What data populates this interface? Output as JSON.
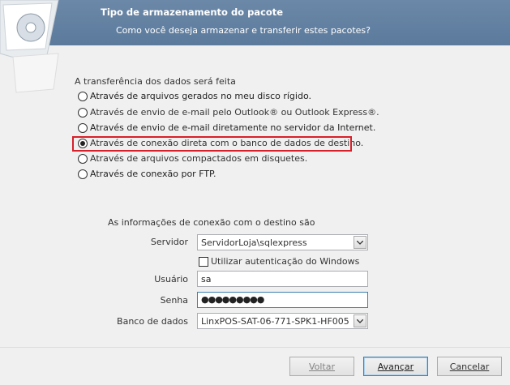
{
  "header": {
    "title": "Tipo de armazenamento do pacote",
    "subtitle": "Como você deseja armazenar e transferir estes pacotes?"
  },
  "transfer": {
    "label": "A transferência dos dados será feita",
    "options": [
      {
        "label": "Através de arquivos gerados no meu disco rígido.",
        "checked": false
      },
      {
        "label": "Através de envio de e-mail pelo Outlook® ou Outlook Express®.",
        "checked": false
      },
      {
        "label": "Através de envio de e-mail diretamente no servidor da Internet.",
        "checked": false
      },
      {
        "label": "Através de conexão direta com o banco de dados de destino.",
        "checked": true
      },
      {
        "label": "Através de arquivos compactados em disquetes.",
        "checked": false
      },
      {
        "label": "Através de conexão por FTP.",
        "checked": false
      }
    ]
  },
  "connection": {
    "label": "As informações de conexão com o destino são",
    "server_label": "Servidor",
    "server_value": "ServidorLoja\\sqlexpress",
    "windows_auth_label": "Utilizar autenticação do Windows",
    "user_label": "Usuário",
    "user_value": "sa",
    "password_label": "Senha",
    "password_value": "●●●●●●●●●",
    "database_label": "Banco de dados",
    "database_value": "LinxPOS-SAT-06-771-SPK1-HF005"
  },
  "buttons": {
    "back": "Voltar",
    "next": "Avançar",
    "cancel": "Cancelar"
  },
  "colors": {
    "header": "#5b7a9c",
    "highlight": "#d7202a"
  }
}
